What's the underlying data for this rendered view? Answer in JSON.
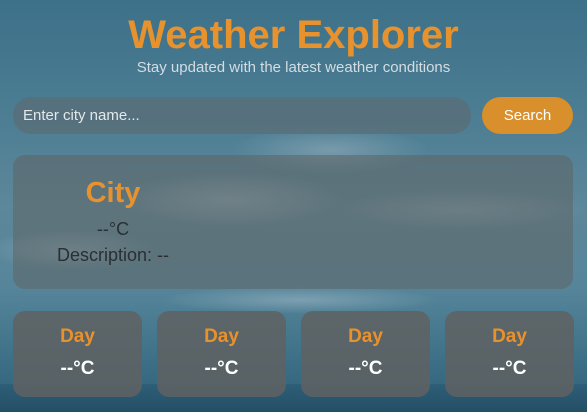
{
  "header": {
    "title": "Weather Explorer",
    "subtitle": "Stay updated with the latest weather conditions"
  },
  "search": {
    "placeholder": "Enter city name...",
    "value": "",
    "button_label": "Search"
  },
  "current": {
    "city": "City",
    "temperature": "--°C",
    "description": "Description: --"
  },
  "forecast": [
    {
      "day": "Day",
      "temperature": "--°C"
    },
    {
      "day": "Day",
      "temperature": "--°C"
    },
    {
      "day": "Day",
      "temperature": "--°C"
    },
    {
      "day": "Day",
      "temperature": "--°C"
    }
  ],
  "colors": {
    "accent": "#e8922e",
    "button": "#d98f2b"
  }
}
